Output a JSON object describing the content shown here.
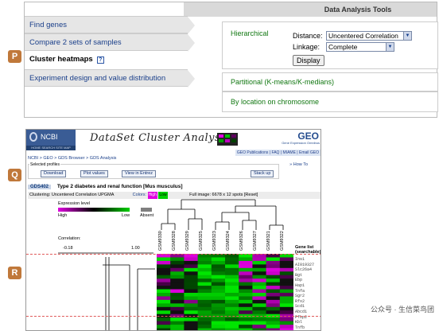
{
  "top_panel": {
    "header": "Data Analysis Tools",
    "tabs": [
      {
        "label": "Find genes"
      },
      {
        "label": "Compare 2 sets of samples"
      },
      {
        "label": "Cluster heatmaps"
      },
      {
        "label": "Experiment design and value distribution"
      }
    ],
    "help_glyph": "?",
    "options": {
      "hierarchical": "Hierarchical",
      "distance_label": "Distance:",
      "distance_value": "Uncentered Correlation",
      "linkage_label": "Linkage:",
      "linkage_value": "Complete",
      "display_button": "Display",
      "partitional": "Partitional (K-means/K-medians)",
      "by_location": "By location on chromosome"
    }
  },
  "markers": {
    "p": "P",
    "q": "Q",
    "r": "R"
  },
  "bottom_panel": {
    "ncbi_logo": "NCBI",
    "ncbi_sub": "HOME  SEARCH  SITE MAP",
    "banner_title": "DataSet Cluster Analysis",
    "geo_logo": "GEO",
    "geo_sub": "Gene Expression Omnibus",
    "nav_links": "GEO Publications | FAQ | MIAME | Email GEO",
    "breadcrumb": "NCBI > GEO > GDS Browser > GDS Analysis",
    "how_to": "» How To",
    "selected_profiles": "Selected profiles",
    "buttons": {
      "download": "Download",
      "plot_values": "Plot values",
      "view_in_entrez": "View in Entrez",
      "stack_up": "Stack up"
    },
    "gds_id": "GDS402",
    "gds_title": "Type 2 diabetes and renal function [Mus musculus]",
    "clustering": "Clustering: Uncentered Correlation UPGMA",
    "colors_label": "Colors:",
    "colors": {
      "high": "High",
      "low": "Low"
    },
    "full_image": "Full image: 6678 x 12 spots [Reset]",
    "expression_level": "Expression level",
    "high": "High",
    "low": "Low",
    "absent": "Absent",
    "correlation": "Correlation:",
    "corr_min": "-0.18",
    "corr_max": "1.00",
    "samples": [
      "GSM9330",
      "GSM9328",
      "GSM9329",
      "GSM9325",
      "GSM9323",
      "GSM9324",
      "GSM9326",
      "GSM9327",
      "GSM9321",
      "GSM9322"
    ],
    "gene_list_header": "Gene list (searchable)",
    "genes": [
      "Ins1",
      "AI019327",
      "Slc26a4",
      "Bgt",
      "Ebp",
      "Hap1",
      "Tnfa",
      "Sgr2",
      "Rfx2",
      "Scd1",
      "Abcd1",
      "Pfbp2",
      "Kbl",
      "Tnfb"
    ],
    "colors_hex": {
      "high": "#e100e0",
      "low": "#00d000",
      "absent": "#7f7f7f"
    }
  },
  "watermark": "公众号 · 生信菜鸟团",
  "colors": {
    "accent_orange": "#c0783a",
    "ncbi_blue": "#3a5c95",
    "link_green": "#117711"
  }
}
